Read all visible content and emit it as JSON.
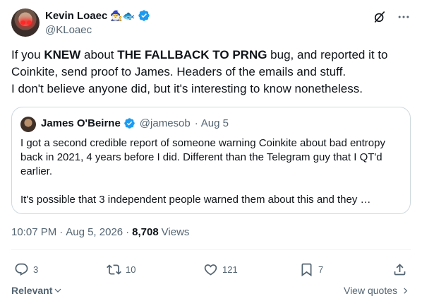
{
  "author": {
    "display_name": "Kevin Loaec",
    "emoji": "🧙‍♂️🐟",
    "handle": "@KLoaec"
  },
  "tweet": {
    "segments": [
      {
        "text": "If you ",
        "bold": false
      },
      {
        "text": "KNEW",
        "bold": true
      },
      {
        "text": " about ",
        "bold": false
      },
      {
        "text": "THE FALLBACK TO PRNG",
        "bold": true
      },
      {
        "text": " bug, and reported it to Coinkite, send proof to James. Headers of the emails and stuff.",
        "bold": false
      },
      {
        "text": "\nI don't believe anyone did, but it's interesting to know nonetheless.",
        "bold": false
      }
    ]
  },
  "quote": {
    "display_name": "James O'Beirne",
    "handle": "@jamesob",
    "separator": "·",
    "date": "Aug 5",
    "paragraph1": "I got a second credible report of someone warning Coinkite about bad entropy back in 2021, 4 years before I did. Different than the Telegram guy that I QT'd earlier.",
    "paragraph2": "It's possible that 3 independent people warned them about this and they …"
  },
  "meta": {
    "time": "10:07 PM",
    "dot1": "·",
    "date": "Aug 5, 2026",
    "dot2": "·",
    "views_count": "8,708",
    "views_label": "Views"
  },
  "actions": {
    "replies": "3",
    "reposts": "10",
    "likes": "121",
    "bookmarks": "7"
  },
  "footer": {
    "sort_label": "Relevant",
    "view_quotes_label": "View quotes"
  },
  "colors": {
    "verified": "#1d9bf0",
    "text": "#0f1419",
    "secondary": "#536471",
    "border": "#cfd9de"
  },
  "icons": [
    "verified-badge-icon",
    "grok-icon",
    "more-icon",
    "reply-icon",
    "repost-icon",
    "like-icon",
    "bookmark-icon",
    "share-icon",
    "chevron-down-icon",
    "chevron-right-icon"
  ]
}
